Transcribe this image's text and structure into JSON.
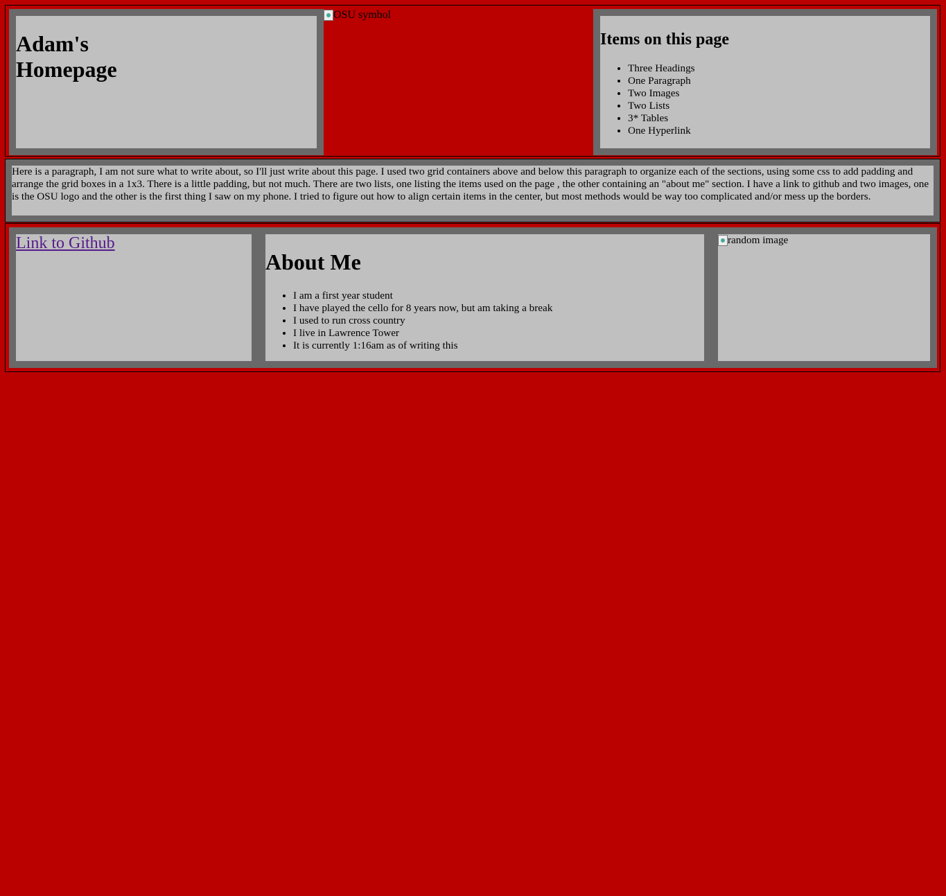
{
  "header": {
    "site_title": "Adam's Homepage",
    "osu_image_alt": "OSU symbol",
    "items_title": "Items on this page",
    "items": [
      "Three Headings",
      "One Paragraph",
      "Two Images",
      "Two Lists",
      "3* Tables",
      "One Hyperlink"
    ]
  },
  "paragraph": "Here is a paragraph, I am not sure what to write about, so I'll just write about this page. I used two grid containers above and below this paragraph to organize each of the sections, using some css to add padding and arrange the grid boxes in a 1x3. There is a little padding, but not much. There are two lists, one listing the items used on the page , the other containing an \"about me\" section. I have a link to github and two images, one is the OSU logo and the other is the first thing I saw on my phone. I tried to figure out how to align certain items in the center, but most methods would be way too complicated and/or mess up the borders.",
  "footer": {
    "link_label": "Link to Github",
    "about_title": "About Me",
    "about_items": [
      "I am a first year student",
      "I have played the cello for 8 years now, but am taking a break",
      "I used to run cross country",
      "I live in Lawrence Tower",
      "It is currently 1:16am as of writing this"
    ],
    "random_image_alt": "random image"
  },
  "colors": {
    "page_background": "#bb0000",
    "box_border": "#696969",
    "box_fill": "#c0c0c0",
    "visited_link": "#551a8b"
  },
  "icons": {
    "broken_image": "broken-image-icon"
  }
}
